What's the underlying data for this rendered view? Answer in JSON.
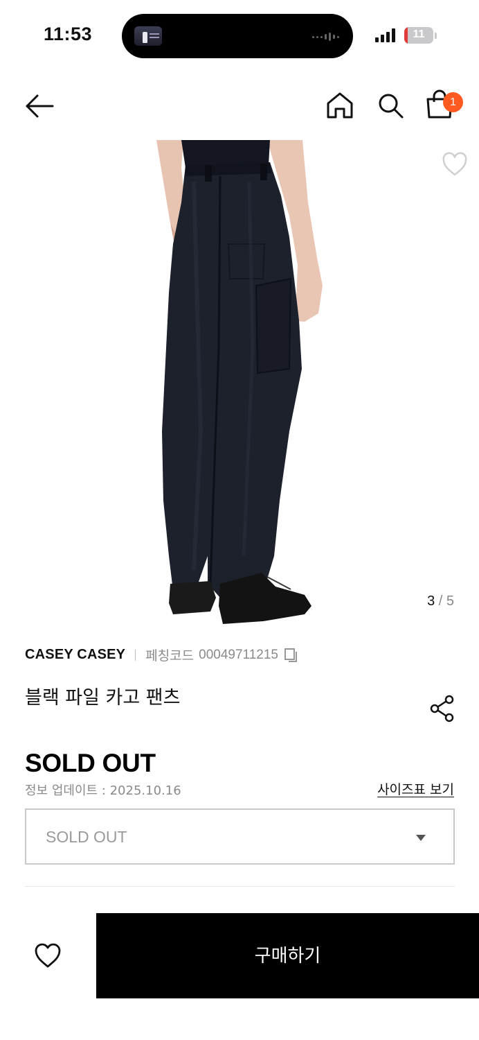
{
  "status_bar": {
    "time": "11:53",
    "battery_level": "11",
    "battery_color": "#e23b3b"
  },
  "header": {
    "back_icon": "arrow-left-icon",
    "home_icon": "home-icon",
    "search_icon": "search-icon",
    "cart_icon": "shopping-bag-icon",
    "cart_count": "1",
    "badge_color": "#ff5a1f"
  },
  "gallery": {
    "current": "3",
    "separator": "/",
    "total": "5",
    "wishlist_icon": "heart-outline-icon"
  },
  "product": {
    "brand": "CASEY CASEY",
    "code_label": "페칭코드",
    "code_value": "00049711215",
    "copy_icon": "copy-icon",
    "title": "블랙 파일 카고 팬츠",
    "share_icon": "share-icon",
    "price_status": "SOLD OUT",
    "update_text": "정보 업데이트 : 2025.10.16",
    "size_chart_link": "사이즈표 보기"
  },
  "option_select": {
    "value": "SOLD OUT",
    "caret_icon": "caret-down-icon"
  },
  "bottom_bar": {
    "wishlist_icon": "heart-outline-icon",
    "buy_label": "구매하기"
  }
}
